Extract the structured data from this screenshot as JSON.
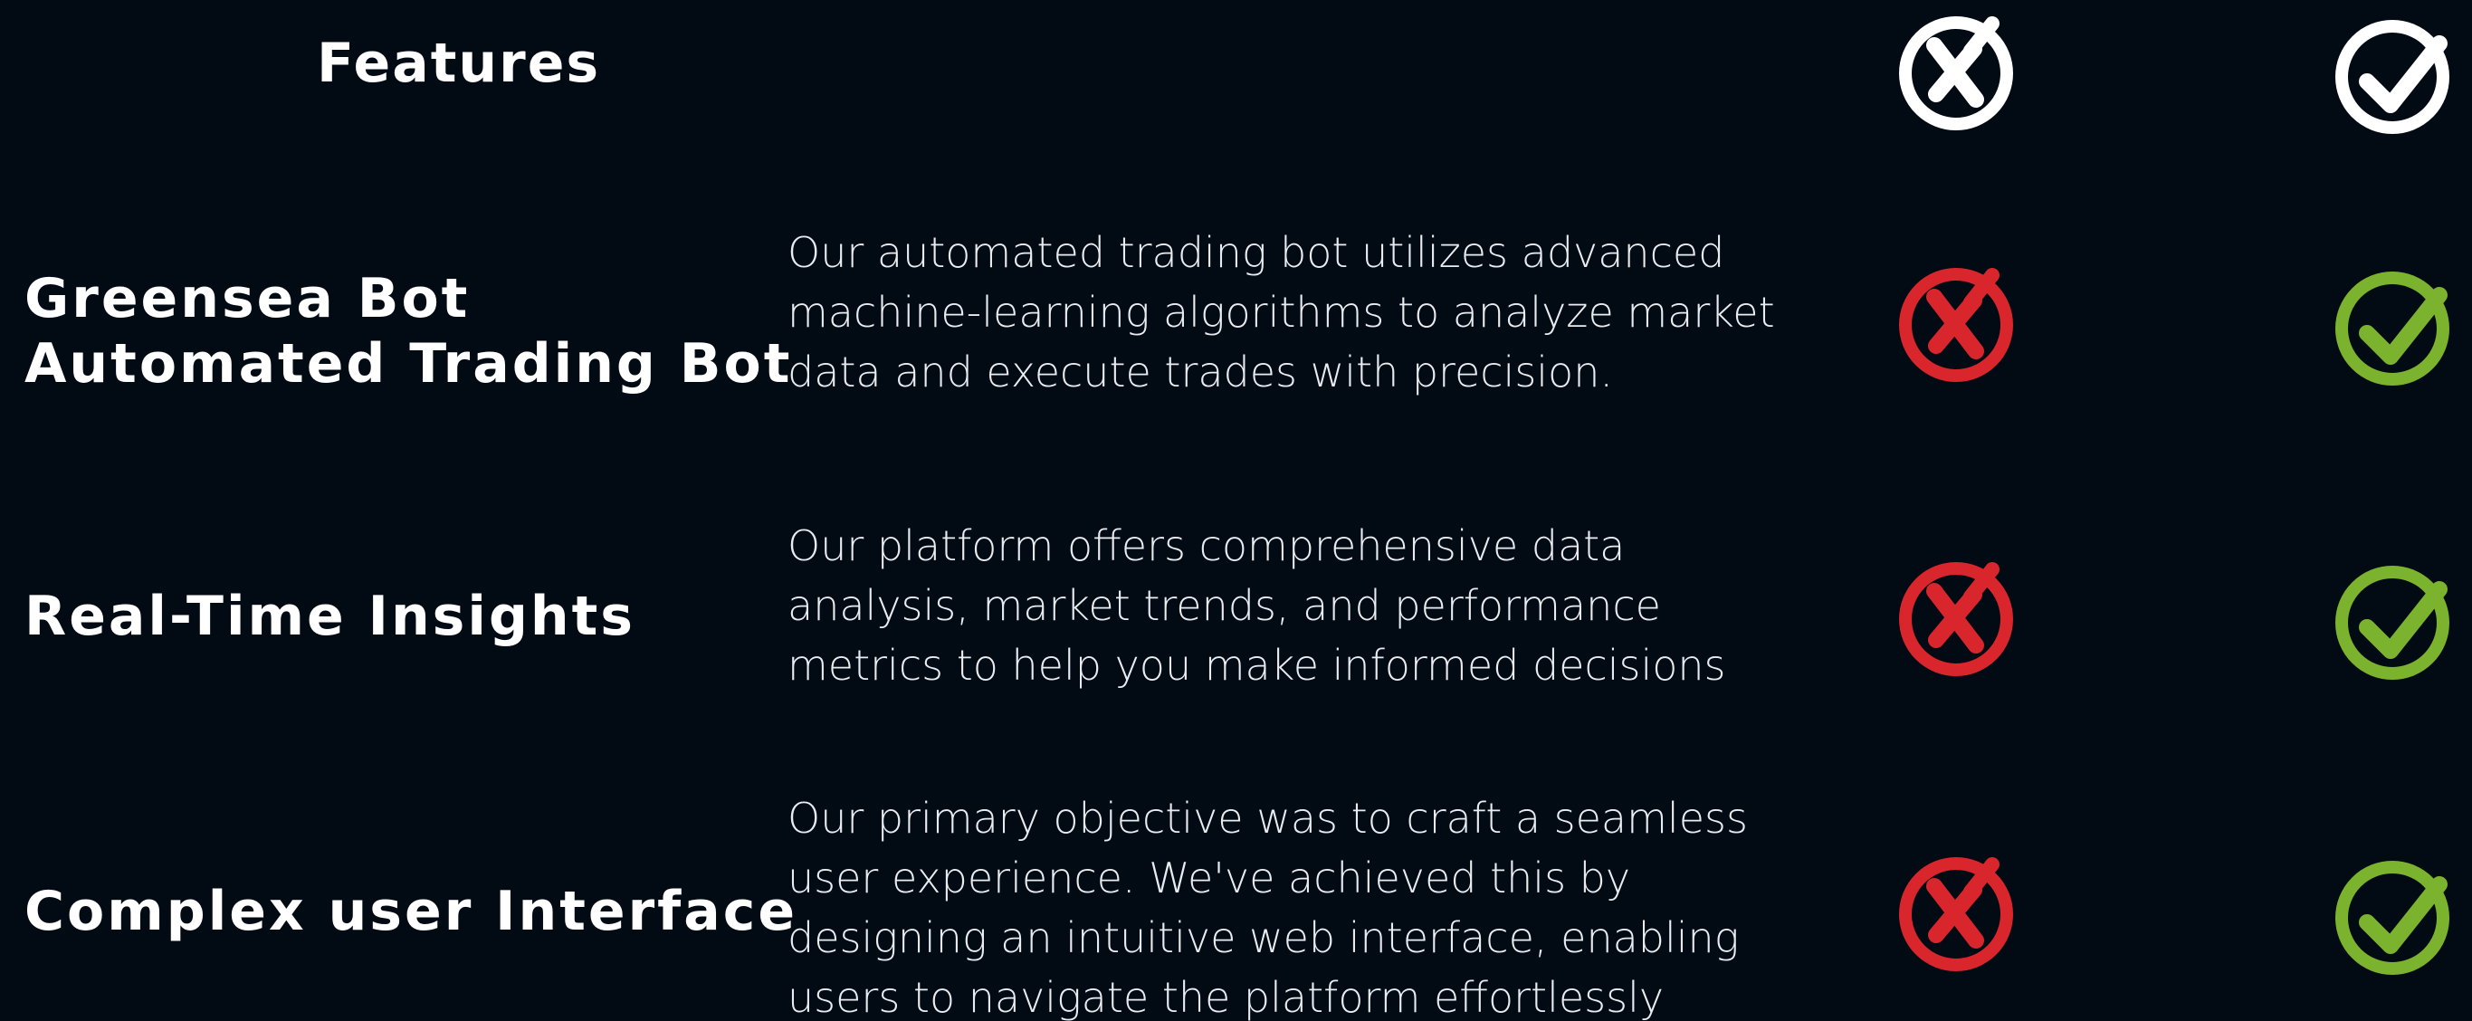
{
  "header": {
    "title": "Features",
    "columns": [
      {
        "icon": "x-circle-icon",
        "color": "#ffffff"
      },
      {
        "icon": "check-circle-icon",
        "color": "#ffffff"
      }
    ]
  },
  "colors": {
    "background": "#020a14",
    "cross": "#d9262c",
    "check": "#7bb32e",
    "header_icon": "#ffffff"
  },
  "features": [
    {
      "title_lines": [
        "Greensea Bot",
        "Automated Trading Bot"
      ],
      "description_lines": [
        "Our automated trading bot utilizes advanced",
        "machine-learning algorithms to analyze market",
        "data and execute trades with precision."
      ],
      "competitor": "x-circle-icon",
      "ours": "check-circle-icon"
    },
    {
      "title_lines": [
        "Real-Time Insights"
      ],
      "description_lines": [
        "Our platform offers comprehensive data",
        "analysis, market trends, and performance",
        "metrics to help you make informed decisions"
      ],
      "competitor": "x-circle-icon",
      "ours": "check-circle-icon"
    },
    {
      "title_lines": [
        "Complex user Interface"
      ],
      "description_lines": [
        "Our primary objective was to craft a seamless",
        "user experience. We've achieved this by",
        "designing an intuitive web interface, enabling",
        "users to navigate the platform effortlessly"
      ],
      "competitor": "x-circle-icon",
      "ours": "check-circle-icon"
    }
  ]
}
